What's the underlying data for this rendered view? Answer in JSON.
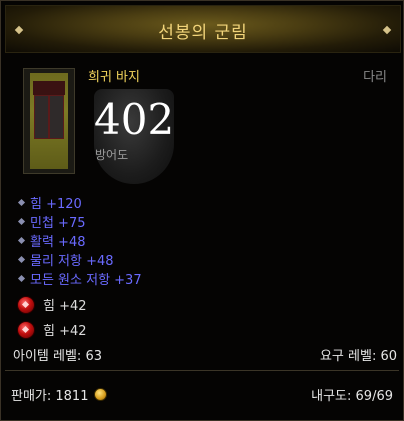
{
  "header": {
    "title": "선봉의 군림"
  },
  "item": {
    "name": "희귀 바지",
    "slot": "다리",
    "defense_value": "402",
    "defense_label": "방어도"
  },
  "affixes": [
    {
      "text": "힘 +120"
    },
    {
      "text": "민첩 +75"
    },
    {
      "text": "활력 +48"
    },
    {
      "text": "물리 저항 +48"
    },
    {
      "text": "모든 원소 저항 +37"
    }
  ],
  "sockets": [
    {
      "text": "힘 +42",
      "gem": "red-gem-icon"
    },
    {
      "text": "힘 +42",
      "gem": "red-gem-icon"
    }
  ],
  "levels": {
    "item_level": "아이템 레벨: 63",
    "required_level": "요구 레벨: 60"
  },
  "footer": {
    "sell_label": "판매가: 1811",
    "durability": "내구도: 69/69"
  },
  "colors": {
    "title": "#f2d47a",
    "rare_name": "#f2d45c",
    "affix": "#6a6aff"
  }
}
